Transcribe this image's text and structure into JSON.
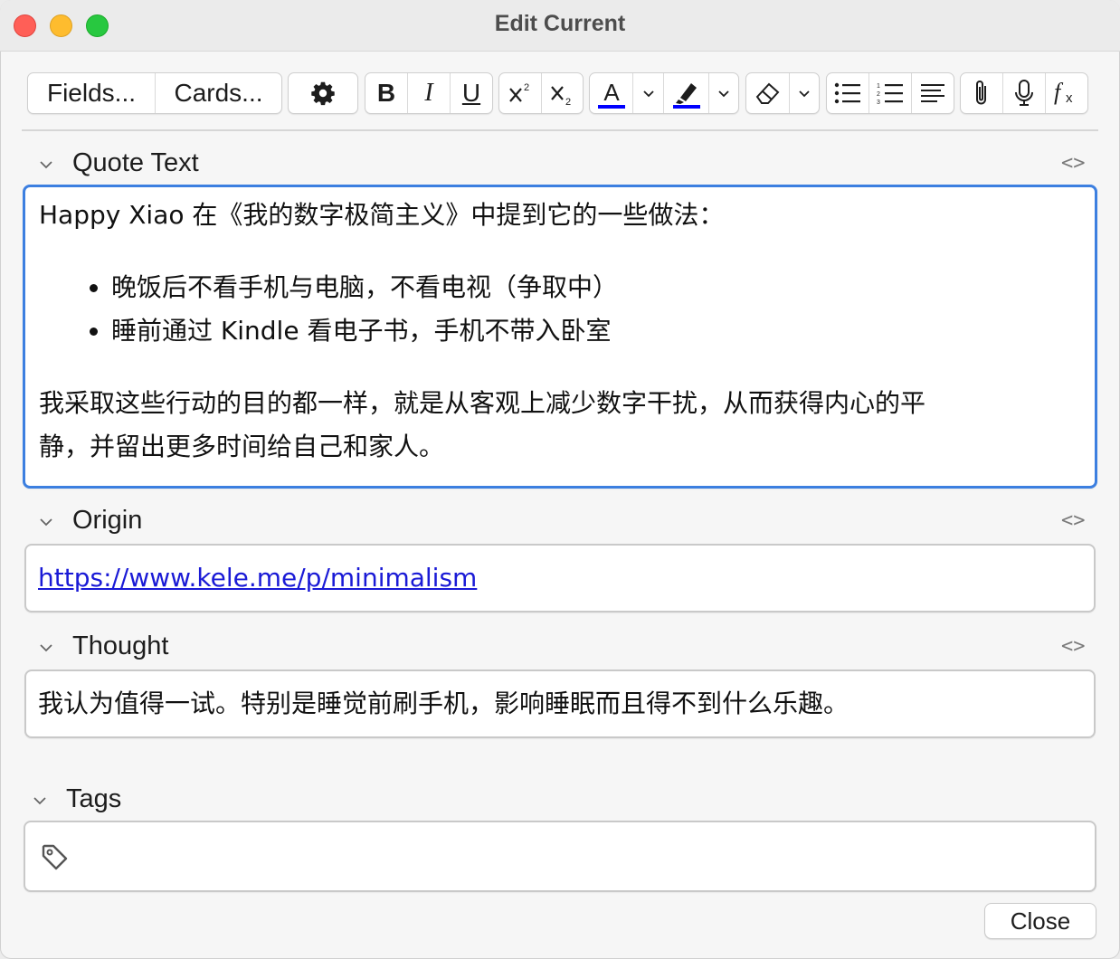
{
  "window": {
    "title": "Edit Current"
  },
  "toolbar": {
    "fields_label": "Fields...",
    "cards_label": "Cards...",
    "bold_label": "B",
    "italic_label": "I",
    "underline_label": "U",
    "text_color": "#0000ff",
    "highlight_color": "#0000ff"
  },
  "fields": [
    {
      "name": "Quote Text",
      "intro": "Happy Xiao 在《我的数字极简主义》中提到它的一些做法：",
      "bullets": [
        "晚饭后不看手机与电脑，不看电视（争取中）",
        "睡前通过 Kindle 看电子书，手机不带入卧室"
      ],
      "line1": "我采取这些行动的目的都一样，就是从客观上减少数字干扰，从而获得内心的平",
      "line2": "静，并留出更多时间给自己和家人。"
    },
    {
      "name": "Origin",
      "value": "https://www.kele.me/p/minimalism"
    },
    {
      "name": "Thought",
      "value": "我认为值得一试。特别是睡觉前刷手机，影响睡眠而且得不到什么乐趣。"
    }
  ],
  "tags": {
    "label": "Tags",
    "value": ""
  },
  "footer": {
    "close_label": "Close"
  },
  "colors": {
    "focus_border": "#3c7fe0",
    "link": "#1a1ad6"
  }
}
